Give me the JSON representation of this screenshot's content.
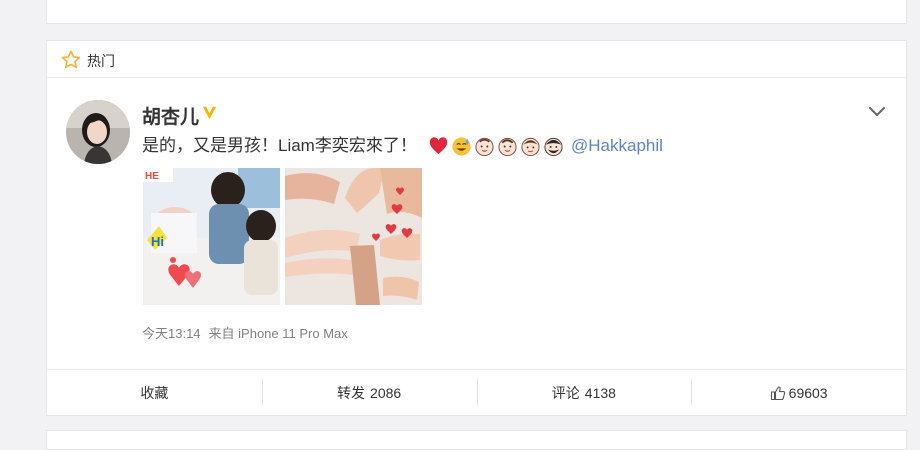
{
  "section": {
    "title": "热门",
    "icon": "star-icon"
  },
  "post": {
    "author": "胡杏儿",
    "verified_icon": "verified-v-badge",
    "text": "是的，又是男孩！Liam李奕宏來了！",
    "emojis": [
      "heart-emoji",
      "sweat-smile-emoji",
      "baby-face-emoji",
      "baby-face-emoji",
      "boy-face-emoji",
      "man-face-emoji"
    ],
    "mention": "@Hakkaphil",
    "time": "今天13:14",
    "source": "来自 iPhone 11 Pro Max",
    "images": [
      "photo-newborn-siblings",
      "photo-family-hands"
    ]
  },
  "actions": {
    "favorite_label": "收藏",
    "repost_label": "转发",
    "repost_count": "2086",
    "comment_label": "评论",
    "comment_count": "4138",
    "like_count": "69603"
  },
  "colors": {
    "link": "#5d84c4",
    "verified": "#f6b500",
    "meta": "#808080",
    "star": "#f5b23c"
  }
}
